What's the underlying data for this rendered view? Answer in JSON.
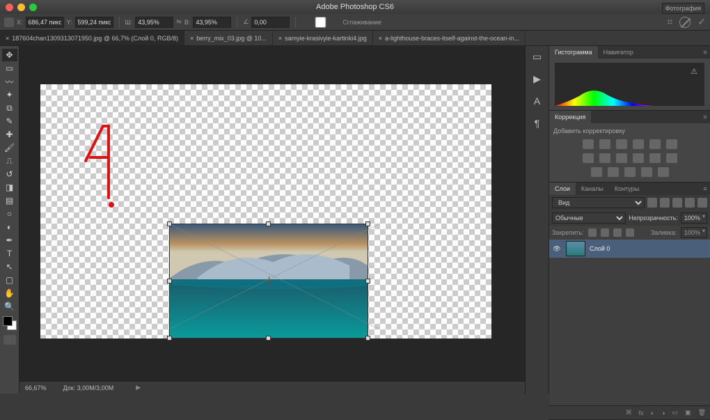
{
  "app_title": "Adobe Photoshop CS6",
  "workspace_mode": "Фотография",
  "options_bar": {
    "x_label": "X:",
    "x_value": "686,47 пикс",
    "y_label": "Y:",
    "y_value": "599,24 пикс",
    "w_label": "Ш:",
    "w_value": "43,95%",
    "h_label": "В:",
    "h_value": "43,95%",
    "angle_label": "∠",
    "angle_value": "0,00",
    "smooth_label": "Сглаживание"
  },
  "doc_tabs": [
    {
      "label": "187604chan1309313071950.jpg @ 66,7% (Слой 0, RGB/8)",
      "active": true,
      "close": "×"
    },
    {
      "label": "berry_mix_03.jpg @ 10...",
      "active": false,
      "close": "×"
    },
    {
      "label": "samyie-krasivyie-kartinki4.jpg",
      "active": false,
      "close": "×"
    },
    {
      "label": "a-lighthouse-braces-itself-against-the-ocean-in...",
      "active": false,
      "close": "×"
    }
  ],
  "status_bar": {
    "zoom": "66,67%",
    "doc": "Док: 3,00M/3,00M"
  },
  "right_panels": {
    "histogram": {
      "tabs": [
        "Гистограмма",
        "Навигатор"
      ],
      "active": 0
    },
    "adjustments": {
      "title": "Коррекция",
      "hint": "Добавить корректировку"
    },
    "layers": {
      "tabs": [
        "Слои",
        "Каналы",
        "Контуры"
      ],
      "active": 0,
      "filter_hint": "Вид",
      "blend_mode": "Обычные",
      "opacity_label": "Непрозрачность:",
      "opacity_value": "100%",
      "lock_label": "Закрепить:",
      "fill_label": "Заливка:",
      "fill_value": "100%",
      "items": [
        {
          "name": "Слой 0"
        }
      ]
    }
  },
  "colors": {
    "accent": "#4a5f7a",
    "brush": "#d11"
  }
}
